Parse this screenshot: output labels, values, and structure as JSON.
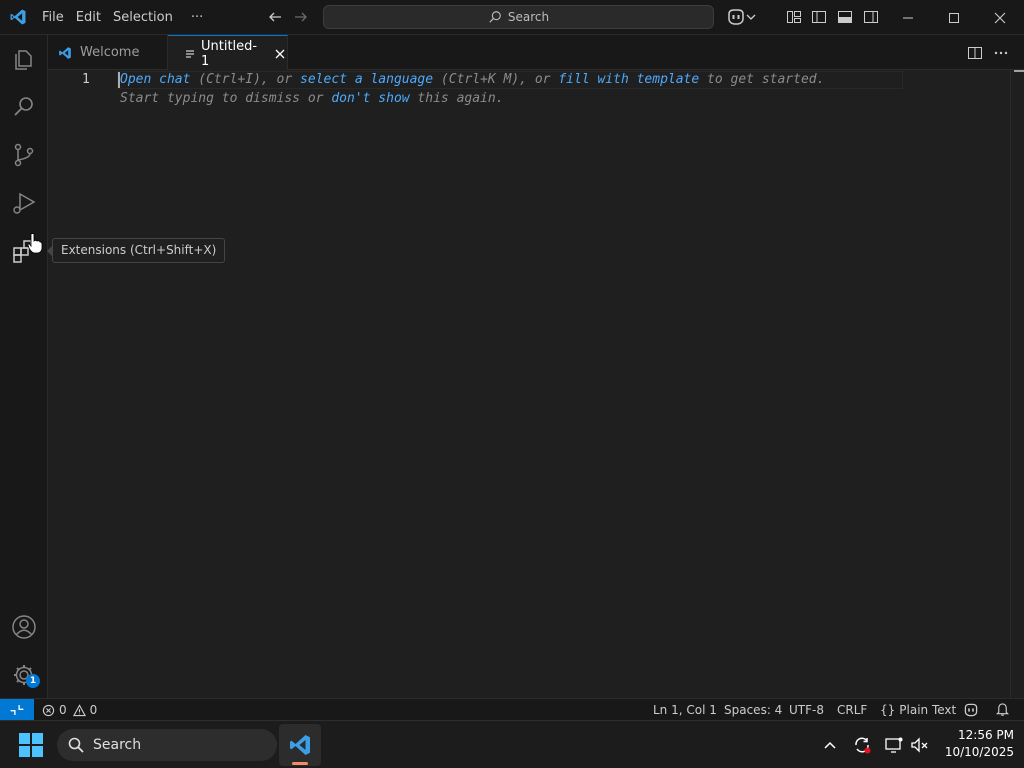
{
  "titlebar": {
    "menu": [
      "File",
      "Edit",
      "Selection"
    ],
    "more": "···",
    "search_label": "Search"
  },
  "tabs": [
    {
      "label": "Welcome"
    },
    {
      "label": "Untitled-1"
    }
  ],
  "editor": {
    "line_number": "1",
    "hint_line1": {
      "link1": "Open chat",
      "t1": " (Ctrl+I), or ",
      "link2": "select a language",
      "t2": " (Ctrl+K M), or ",
      "link3": "fill with template",
      "t3": " to get started."
    },
    "hint_line2": {
      "t1": "Start typing to dismiss or ",
      "link1": "don't show",
      "t2": " this again."
    }
  },
  "tooltip": "Extensions (Ctrl+Shift+X)",
  "activity": {
    "settings_badge": "1"
  },
  "statusbar": {
    "errors": "0",
    "warnings": "0",
    "position": "Ln 1, Col 1",
    "spaces": "Spaces: 4",
    "encoding": "UTF-8",
    "eol": "CRLF",
    "language_braces": "{}",
    "language": "Plain Text"
  },
  "taskbar": {
    "search_label": "Search",
    "time": "12:56 PM",
    "date": "10/10/2025"
  },
  "colors": {
    "accent": "#0078d4",
    "link": "#4daafc",
    "editor_bg": "#1f1f1f",
    "chrome_bg": "#181818"
  }
}
